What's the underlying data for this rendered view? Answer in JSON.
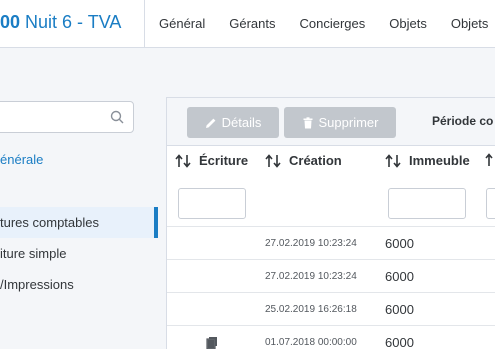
{
  "header": {
    "title_number": "00",
    "title_rest": " Nuit 6 - TVA",
    "tabs": [
      "Général",
      "Gérants",
      "Concierges",
      "Objets",
      "Objets"
    ]
  },
  "sidebar": {
    "search_placeholder": "",
    "link_general": "énérale",
    "items": [
      {
        "label": "tures comptables",
        "active": true
      },
      {
        "label": "iture simple",
        "active": false
      },
      {
        "label": "/Impressions",
        "active": false
      }
    ]
  },
  "toolbar": {
    "details_label": "Détails",
    "delete_label": "Supprimer",
    "periode_label": "Période co"
  },
  "table": {
    "columns": [
      "Écriture",
      "Création",
      "Immeuble"
    ],
    "rows": [
      {
        "creation": "27.02.2019 10:23:24",
        "immeuble": "6000",
        "has_icon": false
      },
      {
        "creation": "27.02.2019 10:23:24",
        "immeuble": "6000",
        "has_icon": false
      },
      {
        "creation": "25.02.2019 16:26:18",
        "immeuble": "6000",
        "has_icon": false
      },
      {
        "creation": "01.07.2018 00:00:00",
        "immeuble": "6000",
        "has_icon": true
      }
    ]
  },
  "colors": {
    "accent": "#1a7dc4",
    "button_disabled": "#c2c7cd",
    "background": "#f4f6f9"
  },
  "icons": {
    "search": "search-icon",
    "edit": "pencil-icon",
    "delete": "trash-icon",
    "sort": "sort-arrows-icon",
    "document": "documents-icon"
  }
}
